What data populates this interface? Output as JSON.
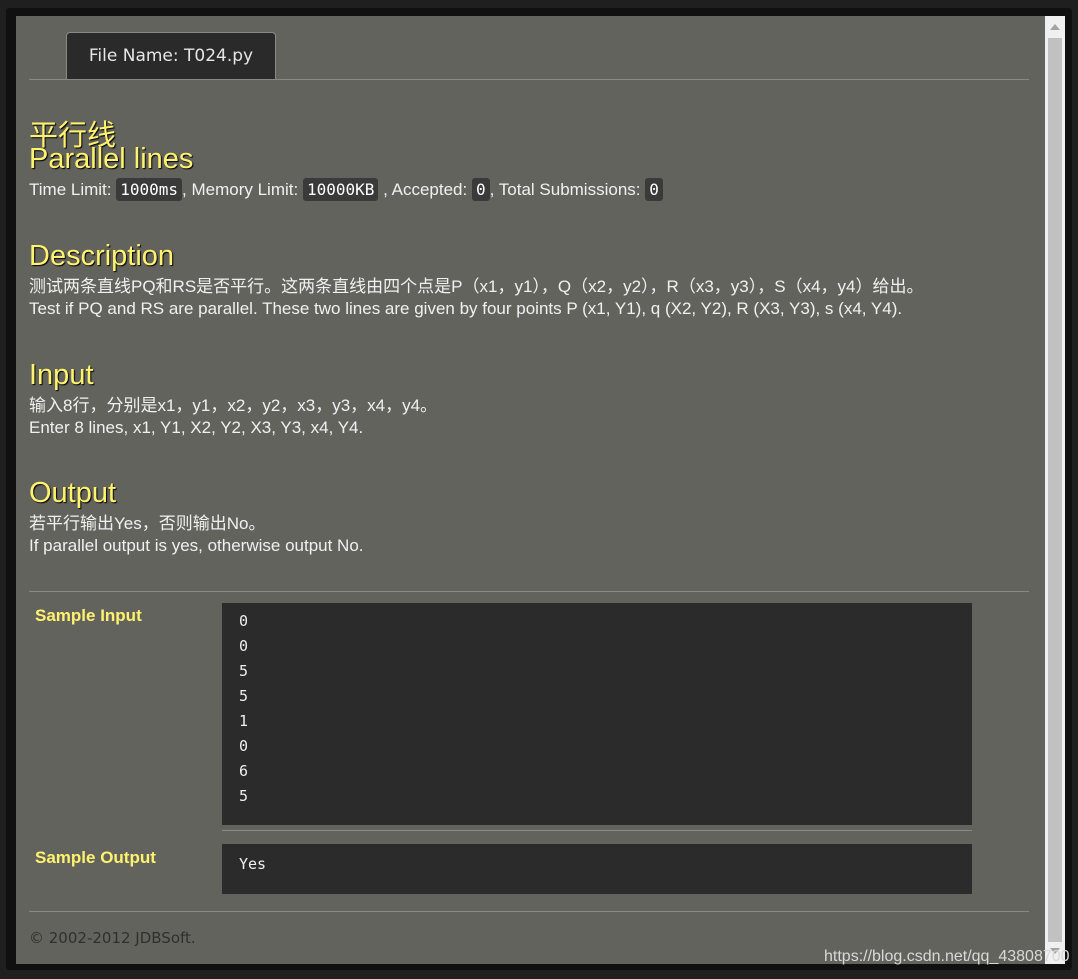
{
  "tab": {
    "label": "File Name: T024.py"
  },
  "problem": {
    "title_cn": "平行线",
    "title_en": "Parallel lines",
    "meta": {
      "time_label": "Time Limit:",
      "time_value": "1000ms",
      "memory_label": ", Memory Limit:",
      "memory_value": "10000KB",
      "accepted_label": ", Accepted:",
      "accepted_value": "0",
      "submissions_label": ", Total Submissions:",
      "submissions_value": "0"
    },
    "description": {
      "heading": "Description",
      "cn": "测试两条直线PQ和RS是否平行。这两条直线由四个点是P（x1，y1），Q（x2，y2），R（x3，y3），S（x4，y4）给出。",
      "en": "Test if PQ and RS are parallel. These two lines are given by four points P (x1, Y1), q (X2, Y2), R (X3, Y3), s (x4, Y4)."
    },
    "input": {
      "heading": "Input",
      "cn": "输入8行，分别是x1，y1，x2，y2，x3，y3，x4，y4。",
      "en": "Enter 8 lines, x1, Y1, X2, Y2, X3, Y3, x4, Y4."
    },
    "output": {
      "heading": "Output",
      "cn": "若平行输出Yes，否则输出No。",
      "en": "If parallel output is yes, otherwise output No."
    }
  },
  "sample_input": {
    "label": "Sample Input",
    "lines": [
      "0",
      "0",
      "5",
      "5",
      "1",
      "0",
      "6",
      "5"
    ]
  },
  "sample_output": {
    "label": "Sample Output",
    "lines": [
      "Yes"
    ]
  },
  "footer": {
    "text": "© 2002-2012  JDBSoft."
  },
  "watermark": {
    "text": "https://blog.csdn.net/qq_43808700"
  }
}
